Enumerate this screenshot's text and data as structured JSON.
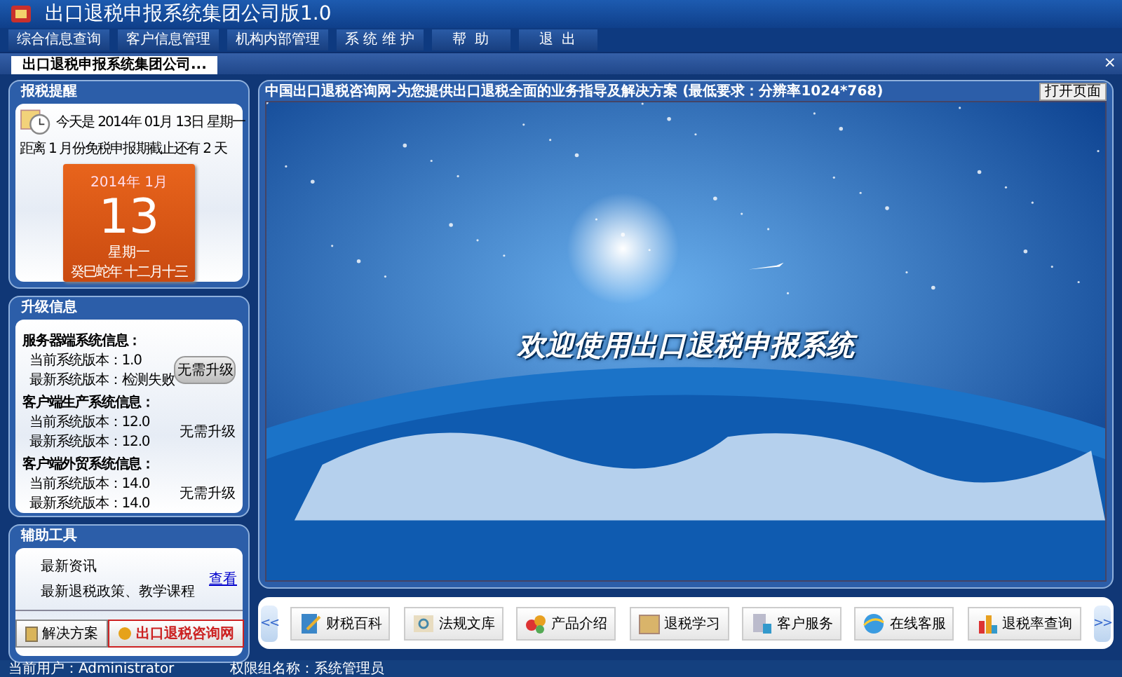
{
  "window": {
    "title": "出口退税申报系统集团公司版1.0"
  },
  "menu": [
    {
      "label": "综合信息查询"
    },
    {
      "label": "客户信息管理"
    },
    {
      "label": "机构内部管理"
    },
    {
      "label": "系 统 维 护"
    },
    {
      "label": "帮  助"
    },
    {
      "label": "退  出"
    }
  ],
  "tabs": [
    {
      "label": "出口退税申报系统集团公司...",
      "selected": true
    }
  ],
  "tab_close": "×",
  "reminder": {
    "title": "报税提醒",
    "today": "今天是 2014年 01月 13日 星期一",
    "deadline": "距离 1 月份免税申报期截止还有 2 天",
    "calendar": {
      "year_month": "2014年  1月",
      "day": "13",
      "weekday": "星期一",
      "lunar": "癸巳蛇年 十二月十三"
    }
  },
  "upgrade": {
    "title": "升级信息",
    "groups": [
      {
        "name": "服务器端系统信息：",
        "current": "当前系统版本：1.0",
        "latest": "最新系统版本：检测失败",
        "action": "无需升级",
        "kind": "button"
      },
      {
        "name": "客户端生产系统信息：",
        "current": "当前系统版本：12.0",
        "latest": "最新系统版本：12.0",
        "action": "无需升级",
        "kind": "text"
      },
      {
        "name": "客户端外贸系统信息：",
        "current": "当前系统版本：14.0",
        "latest": "最新系统版本：14.0",
        "action": "无需升级",
        "kind": "text"
      }
    ]
  },
  "tools": {
    "title": "辅助工具",
    "news_title": "最新资讯",
    "news_text": "最新退税政策、教学课程",
    "news_link": "查看",
    "buttons": [
      {
        "label": "解决方案"
      },
      {
        "label": "出口退税咨询网"
      }
    ]
  },
  "main": {
    "header": "中国出口退税咨询网-为您提供出口退税全面的业务指导及解决方案 (最低要求：分辨率1024*768)",
    "corner_button": "打开页面",
    "welcome": "欢迎使用出口退税申报系统"
  },
  "toolbar": {
    "prev": "<<",
    "next": ">>",
    "items": [
      {
        "label": "财税百科",
        "kind": "book"
      },
      {
        "label": "法规文库",
        "kind": "search"
      },
      {
        "label": "产品介绍",
        "kind": "product"
      },
      {
        "label": "退税学习",
        "kind": "folder"
      },
      {
        "label": "客户服务",
        "kind": "service"
      },
      {
        "label": "在线客服",
        "kind": "globe"
      },
      {
        "label": "退税率查询",
        "kind": "chart"
      }
    ]
  },
  "status_bar": {
    "user": "当前用户：Administrator",
    "group": "权限组名称：系统管理员"
  }
}
